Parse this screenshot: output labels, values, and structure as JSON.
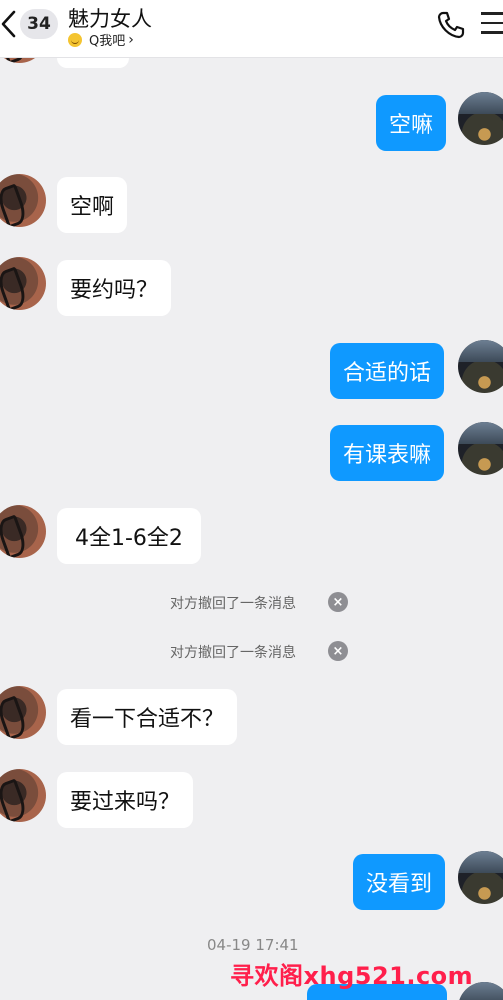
{
  "header": {
    "unread_count": "34",
    "contact_name": "魅力女人",
    "status_text": "Q我吧",
    "status_chevron": "›",
    "icons": [
      "back-arrow-icon",
      "phone-icon",
      "menu-icon"
    ]
  },
  "messages": [
    {
      "side": "right",
      "text": "空嘛"
    },
    {
      "side": "left",
      "text": "空啊"
    },
    {
      "side": "left",
      "text": "要约吗？"
    },
    {
      "side": "right",
      "text": "合适的话"
    },
    {
      "side": "right",
      "text": "有课表嘛"
    },
    {
      "side": "left",
      "text": "4全1-6全2"
    },
    {
      "side": "left",
      "text": "看一下合适不？"
    },
    {
      "side": "left",
      "text": "要过来吗？"
    },
    {
      "side": "right",
      "text": "没看到"
    }
  ],
  "system_notices": [
    {
      "text": "对方撤回了一条消息",
      "icon": "close-icon"
    },
    {
      "text": "对方撤回了一条消息",
      "icon": "close-icon"
    }
  ],
  "timestamp": "04-19 17:41",
  "watermark": "寻欢阁xhg521.com",
  "colors": {
    "outgoing_bubble": "#0f99ff",
    "incoming_bubble": "#ffffff",
    "background": "#efeff1",
    "watermark": "#ff1f4b"
  }
}
